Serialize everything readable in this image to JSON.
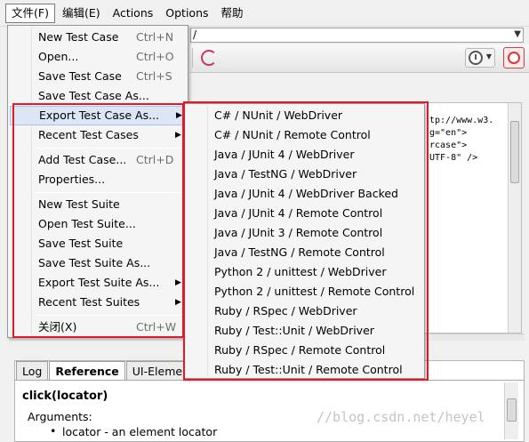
{
  "menubar": {
    "items": [
      {
        "label": "文件(F)",
        "active": true
      },
      {
        "label": "编辑(E)"
      },
      {
        "label": "Actions"
      },
      {
        "label": "Options"
      },
      {
        "label": "帮助"
      }
    ]
  },
  "url_bar": {
    "value": "/"
  },
  "source_panel": {
    "lines": [
      "tp://www.w3.",
      "g=\"en\">",
      "rcase\">",
      "UTF-8\" />"
    ]
  },
  "file_menu": {
    "items": [
      {
        "label": "New Test Case",
        "shortcut": "Ctrl+N"
      },
      {
        "label": "Open...",
        "shortcut": "Ctrl+O"
      },
      {
        "label": "Save Test Case",
        "shortcut": "Ctrl+S"
      },
      {
        "label": "Save Test Case As..."
      },
      {
        "label": "Export Test Case As...",
        "submenu": true
      },
      {
        "label": "Recent Test Cases",
        "submenu": true
      },
      {
        "label": "Add Test Case...",
        "shortcut": "Ctrl+D"
      },
      {
        "label": "Properties..."
      },
      {
        "label": "New Test Suite"
      },
      {
        "label": "Open Test Suite..."
      },
      {
        "label": "Save Test Suite"
      },
      {
        "label": "Save Test Suite As..."
      },
      {
        "label": "Export Test Suite As...",
        "submenu": true
      },
      {
        "label": "Recent Test Suites",
        "submenu": true
      },
      {
        "label": "关闭(X)",
        "shortcut": "Ctrl+W"
      }
    ]
  },
  "export_submenu": {
    "items": [
      "C# / NUnit / WebDriver",
      "C# / NUnit / Remote Control",
      "Java / JUnit 4 / WebDriver",
      "Java / TestNG / WebDriver",
      "Java / JUnit 4 / WebDriver Backed",
      "Java / JUnit 4 / Remote Control",
      "Java / JUnit 3 / Remote Control",
      "Java / TestNG / Remote Control",
      "Python 2 / unittest / WebDriver",
      "Python 2 / unittest / Remote Control",
      "Ruby / RSpec / WebDriver",
      "Ruby / Test::Unit / WebDriver",
      "Ruby / RSpec / Remote Control",
      "Ruby / Test::Unit / Remote Control"
    ]
  },
  "bottom_tabs": [
    {
      "label": "Log"
    },
    {
      "label": "Reference",
      "selected": true
    },
    {
      "label": "UI-Element"
    }
  ],
  "reference": {
    "title": "click(locator)",
    "args_label": "Arguments:",
    "bullet": "locator - an element locator"
  },
  "watermark": "//blog.csdn.net/heyel",
  "colors": {
    "annotation_red": "#e01a2a",
    "highlight": "#dce6f4"
  }
}
